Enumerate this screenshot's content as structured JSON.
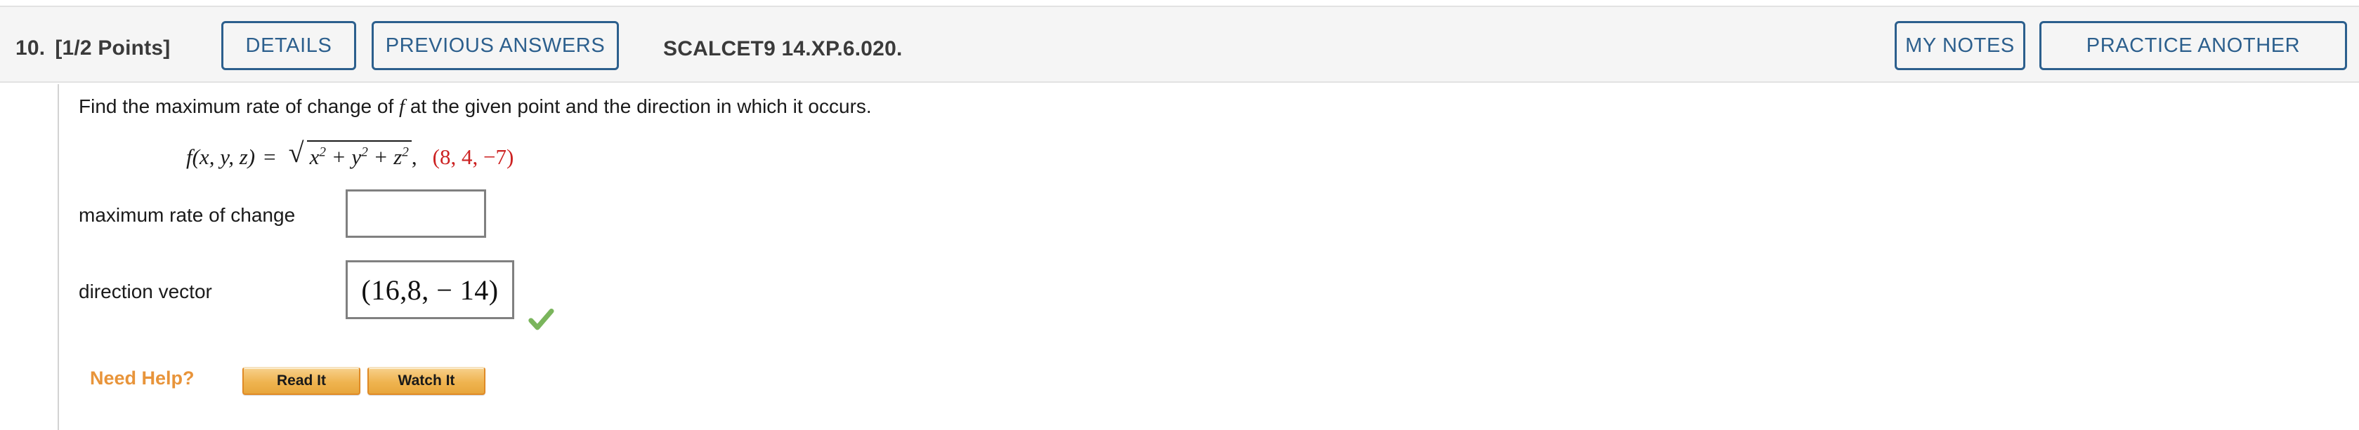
{
  "header": {
    "question_number": "10.",
    "points": "[1/2 Points]",
    "details_label": "DETAILS",
    "previous_answers_label": "PREVIOUS ANSWERS",
    "source_code": "SCALCET9 14.XP.6.020.",
    "my_notes_label": "MY NOTES",
    "practice_another_label": "PRACTICE ANOTHER",
    "button_color": "#2c5f8d",
    "background": "#f5f5f5"
  },
  "body": {
    "prompt_before": "Find the maximum rate of change of ",
    "prompt_variable": "f",
    "prompt_after": " at the given point and the direction in which it occurs.",
    "formula": {
      "function_name": "f(x, y, z)",
      "equals": "=",
      "radicand_base1": "x",
      "radicand_exp1": "2",
      "plus1": " + ",
      "radicand_base2": "y",
      "radicand_exp2": "2",
      "plus2": " + ",
      "radicand_base3": "z",
      "radicand_exp3": "2",
      "comma": ",",
      "point": "(8, 4, −7)",
      "point_color": "#cc2222"
    },
    "answers": [
      {
        "label": "maximum rate of change",
        "value": "",
        "placeholder": "",
        "correct": false
      },
      {
        "label": "direction vector",
        "value": "(16,8, − 14)",
        "placeholder": "",
        "correct": true
      }
    ],
    "check_icon_color": "#7ab55c"
  },
  "help": {
    "title": "Need Help?",
    "title_color": "#e8943a",
    "read_label": "Read It",
    "watch_label": "Watch It"
  }
}
